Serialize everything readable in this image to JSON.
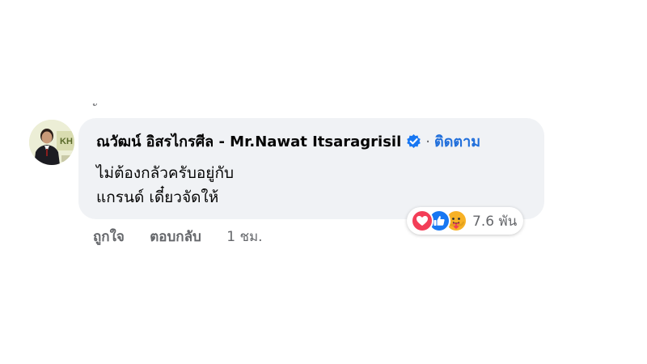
{
  "thread": {
    "mark": "ั"
  },
  "comment": {
    "author_name": "ณวัฒน์ อิสรไกรศีล - Mr.Nawat Itsaragrisil",
    "separator": "·",
    "follow_label": "ติดตาม",
    "text_lines": [
      "ไม่ต้องกลัวครับอยู่กับ",
      "แกรนด์ เดี๋ยวจัดให้"
    ],
    "reactions": {
      "icons": [
        "love",
        "like",
        "care"
      ],
      "count": "7.6 พัน"
    },
    "actions": {
      "like_label": "ถูกใจ",
      "reply_label": "ตอบกลับ",
      "timestamp": "1 ชม."
    }
  },
  "colors": {
    "bubble": "#f0f2f5",
    "link_blue": "#216fdb",
    "verified_blue": "#1877f2",
    "love_red": "#f33e58",
    "muted_text": "#65676b"
  }
}
